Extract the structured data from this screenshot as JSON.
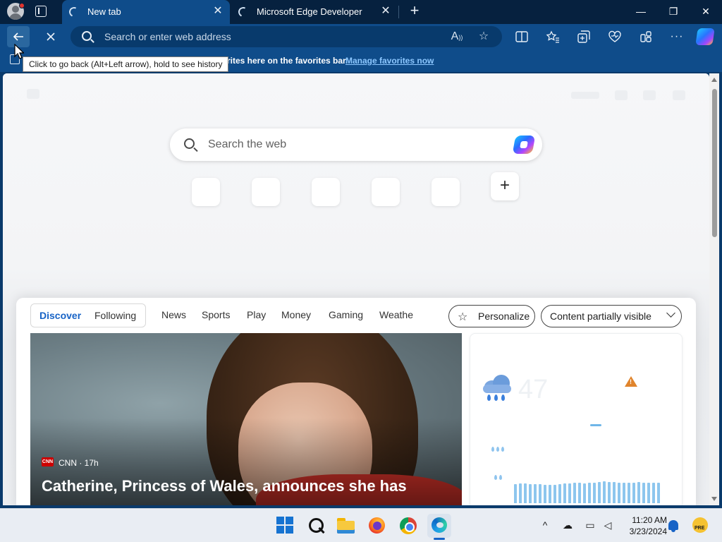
{
  "browser": {
    "tabs": [
      {
        "title": "New tab",
        "active": true
      },
      {
        "title": "Microsoft Edge Developer",
        "active": false
      }
    ],
    "new_tab_symbol": "+",
    "window_controls": {
      "minimize": "—",
      "restore": "❐",
      "close": "✕"
    },
    "address_bar": {
      "placeholder": "Search or enter web address",
      "value": ""
    },
    "favorites_bar": {
      "message_partial": "rites here on the favorites bar.",
      "link": "Manage favorites now"
    },
    "tooltip": "Click to go back (Alt+Left arrow), hold to see history",
    "toolbar_icons": [
      "back-arrow-icon",
      "stop-loading-icon",
      "read-aloud-icon",
      "favorite-star-icon",
      "split-screen-icon",
      "favorites-icon",
      "collections-icon",
      "browser-essentials-icon",
      "extensions-icon",
      "more-menu-icon",
      "copilot-icon"
    ]
  },
  "new_tab_page": {
    "search": {
      "placeholder": "Search the web"
    },
    "quick_links_count": 5,
    "add_site_symbol": "+"
  },
  "feed": {
    "toggle": {
      "discover": "Discover",
      "following": "Following",
      "selected": "Discover"
    },
    "tabs": [
      "News",
      "Sports",
      "Play",
      "Money",
      "Gaming",
      "Weathe"
    ],
    "personalize_label": "Personalize",
    "visibility_label": "Content partially visible",
    "hero": {
      "source": "CNN · 17h",
      "source_logo": "CNN",
      "headline": "Catherine, Princess of Wales, announces she has"
    },
    "weather": {
      "temperature": "47",
      "precipitation_series": [
        0.62,
        0.64,
        0.63,
        0.62,
        0.61,
        0.62,
        0.6,
        0.59,
        0.6,
        0.62,
        0.63,
        0.64,
        0.66,
        0.65,
        0.64,
        0.66,
        0.67,
        0.68,
        0.7,
        0.69,
        0.68,
        0.67,
        0.66,
        0.66,
        0.67,
        0.68,
        0.67,
        0.66,
        0.66,
        0.65
      ]
    }
  },
  "taskbar": {
    "apps": [
      "start-icon",
      "search-icon",
      "file-explorer-icon",
      "firefox-icon",
      "chrome-icon",
      "edge-icon"
    ],
    "time": "11:20 AM",
    "date": "3/23/2024",
    "badge": "PRE"
  },
  "colors": {
    "frame": "#0f4c8a",
    "titlebar": "#06213f",
    "accent": "#1763c6",
    "page": "#f5f6f8"
  }
}
